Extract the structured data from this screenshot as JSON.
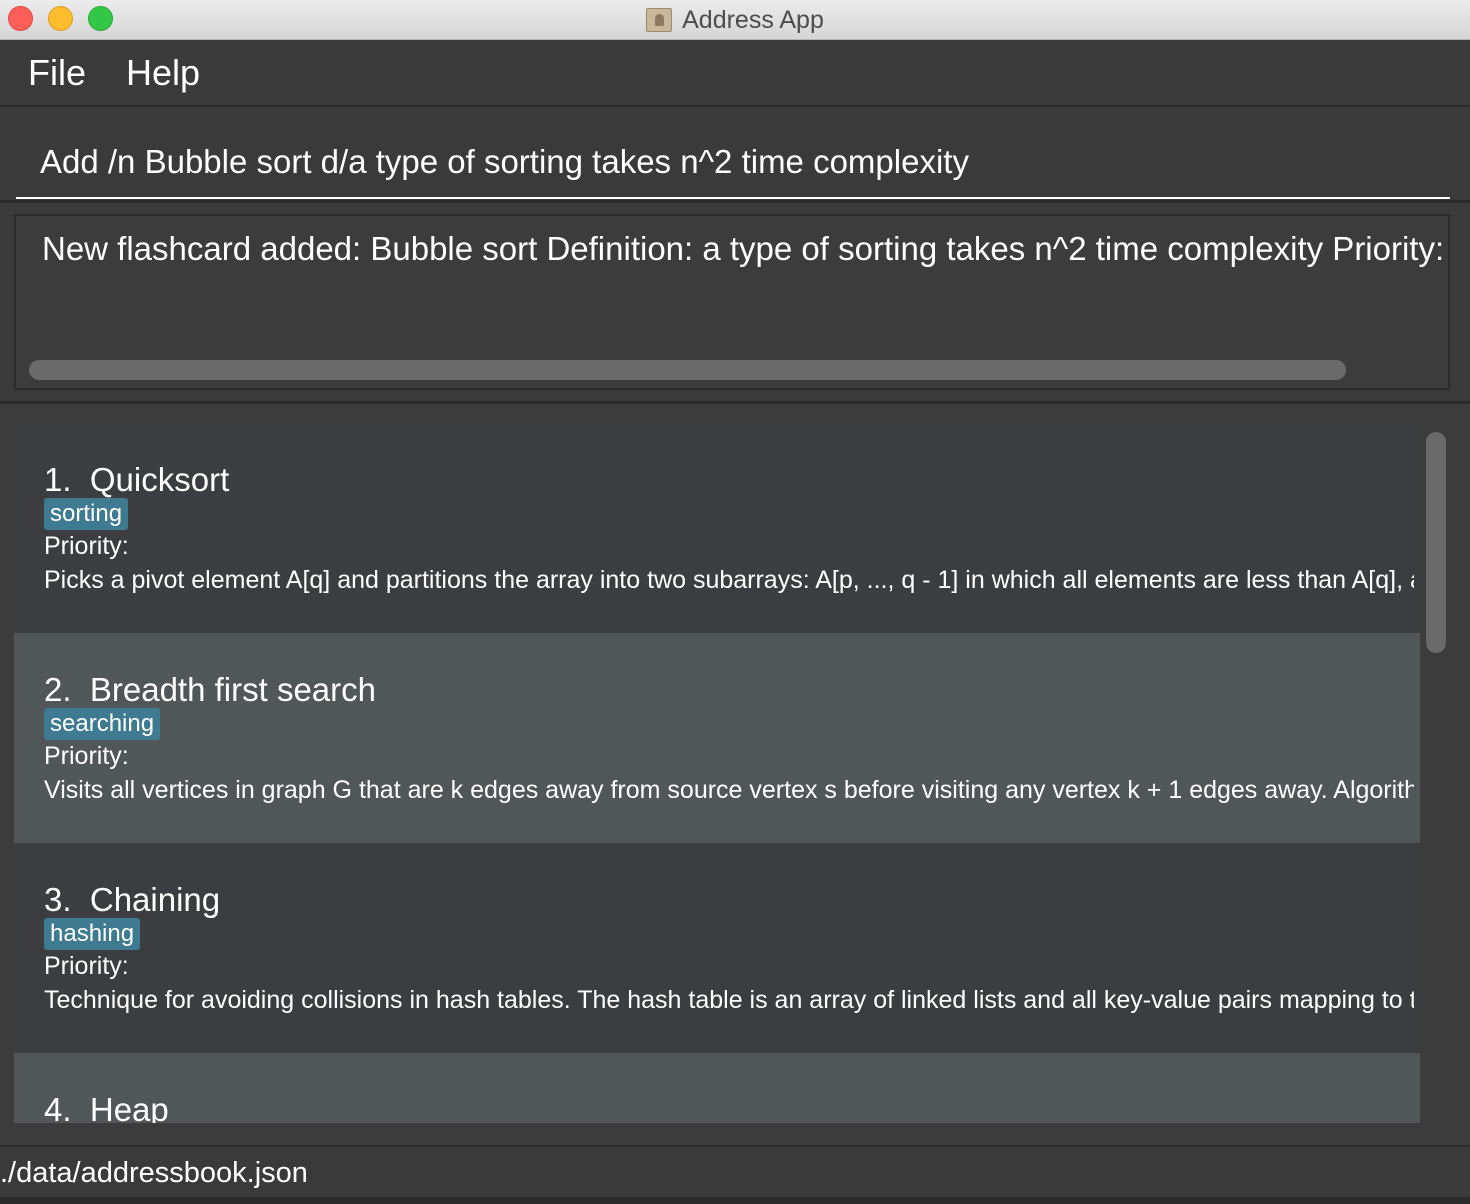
{
  "window": {
    "title": "Address App"
  },
  "menu": {
    "items": [
      "File",
      "Help"
    ]
  },
  "command": {
    "value": "Add /n Bubble sort d/a type of sorting takes n^2 time complexity"
  },
  "result": {
    "text": "New flashcard added: Bubble sort Definition: a type of sorting takes n^2 time complexity Priority: ]"
  },
  "cards": [
    {
      "index": "1.",
      "name": "Quicksort",
      "tag": "sorting",
      "priority": "Priority:",
      "definition": "Picks a pivot element A[q] and partitions the array into two subarrays: A[p, ..., q - 1] in which all elements are less than A[q], a..."
    },
    {
      "index": "2.",
      "name": "Breadth first search",
      "tag": "searching",
      "priority": "Priority:",
      "definition": "Visits all vertices in graph G that are k edges away from source vertex s before visiting any vertex k + 1 edges away. Algorith..."
    },
    {
      "index": "3.",
      "name": "Chaining",
      "tag": "hashing",
      "priority": "Priority:",
      "definition": "Technique for avoiding collisions in hash tables. The hash table is an array of linked lists and all key-value pairs mapping to th..."
    },
    {
      "index": "4.",
      "name": "Heap"
    }
  ],
  "status": {
    "path": "./data/addressbook.json"
  },
  "colors": {
    "background": "#3c3c3d",
    "card_alt": "#515658",
    "tag": "#3e7b91"
  }
}
